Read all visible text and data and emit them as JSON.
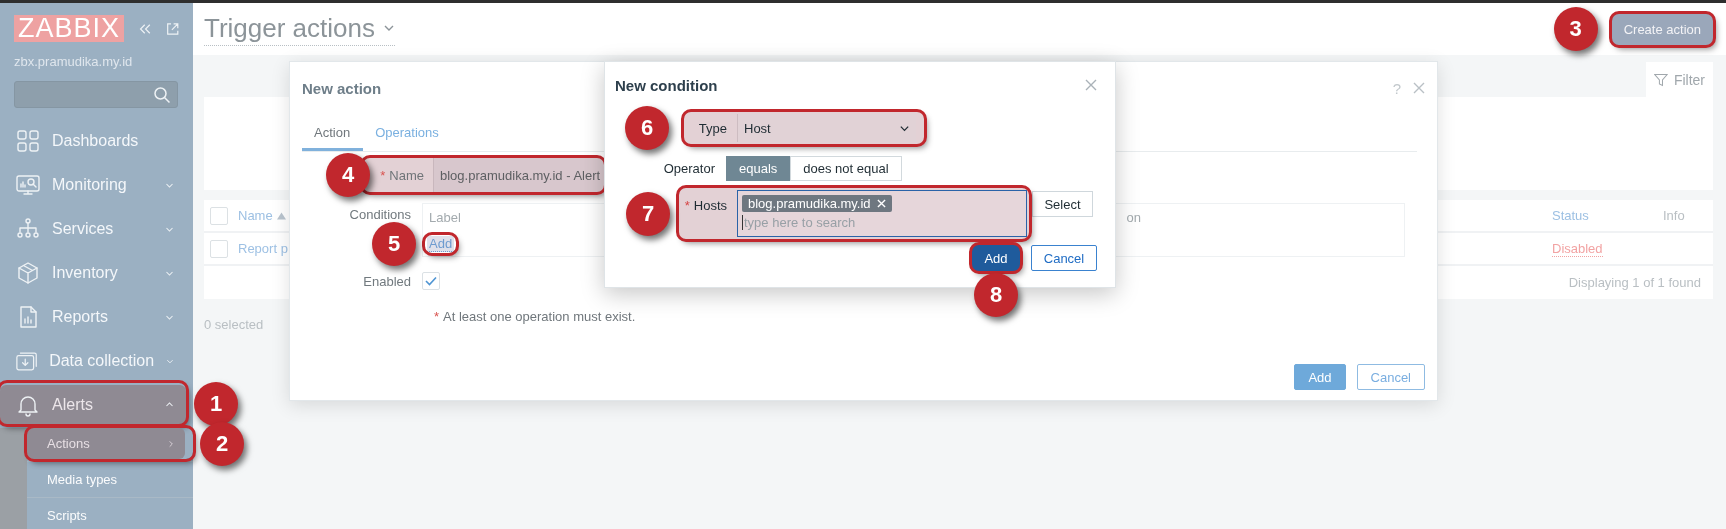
{
  "sidebar": {
    "logo": "ZABBIX",
    "server": "zbx.pramudika.my.id",
    "menu": [
      {
        "label": "Dashboards",
        "submenu": false,
        "expanded": false
      },
      {
        "label": "Monitoring",
        "submenu": true,
        "expanded": false
      },
      {
        "label": "Services",
        "submenu": true,
        "expanded": false
      },
      {
        "label": "Inventory",
        "submenu": true,
        "expanded": false
      },
      {
        "label": "Reports",
        "submenu": true,
        "expanded": false
      },
      {
        "label": "Data collection",
        "submenu": true,
        "expanded": false
      },
      {
        "label": "Alerts",
        "submenu": true,
        "expanded": true,
        "callout": "1",
        "children": [
          {
            "label": "Actions",
            "selected": true,
            "callout": "2"
          },
          {
            "label": "Media types",
            "selected": false
          },
          {
            "label": "Scripts",
            "selected": false
          }
        ]
      }
    ]
  },
  "header": {
    "title": "Trigger actions",
    "create_button": {
      "label": "Create action",
      "callout": "3"
    }
  },
  "filter_tab": {
    "label": "Filter"
  },
  "table": {
    "header_checkbox": {
      "checked": false
    },
    "columns": [
      {
        "label": "Name",
        "sorted": true
      },
      {
        "label": "Status",
        "sorted": false
      },
      {
        "label": "Info",
        "sorted": false
      }
    ],
    "rows": [
      {
        "name": "Report p",
        "status": "Disabled",
        "checked": false
      }
    ],
    "footer": "Displaying 1 of 1 found"
  },
  "selection": "0 selected",
  "action_dialog": {
    "title": "New action",
    "help": "?",
    "tabs": [
      {
        "label": "Action",
        "selected": true
      },
      {
        "label": "Operations",
        "selected": false
      }
    ],
    "name": {
      "marker": "*",
      "label": "Name",
      "value": "blog.pramudika.my.id - Alert",
      "callout": "4"
    },
    "conditions": {
      "label": "Conditions",
      "columns": [
        {
          "label": "Label"
        },
        {
          "label": "on"
        }
      ],
      "add_link": {
        "label": "Add",
        "callout": "5"
      }
    },
    "enabled": {
      "label": "Enabled",
      "checked": true
    },
    "note": {
      "marker": "*",
      "text": "At least one operation must exist."
    },
    "buttons": [
      {
        "label": "Add",
        "kind": "primary"
      },
      {
        "label": "Cancel",
        "kind": "secondary"
      }
    ]
  },
  "condition_dialog": {
    "title": "New condition",
    "type": {
      "label": "Type",
      "value": "Host",
      "callout": "6"
    },
    "operator": {
      "label": "Operator",
      "options": [
        {
          "label": "equals",
          "selected": true
        },
        {
          "label": "does not equal",
          "selected": false
        }
      ]
    },
    "hosts": {
      "marker": "*",
      "label": "Hosts",
      "tags": [
        {
          "label": "blog.pramudika.my.id"
        }
      ],
      "placeholder": "type here to search",
      "callout": "7"
    },
    "select_button": "Select",
    "buttons": [
      {
        "label": "Add",
        "kind": "primary",
        "callout": "8"
      },
      {
        "label": "Cancel",
        "kind": "secondary"
      }
    ]
  }
}
